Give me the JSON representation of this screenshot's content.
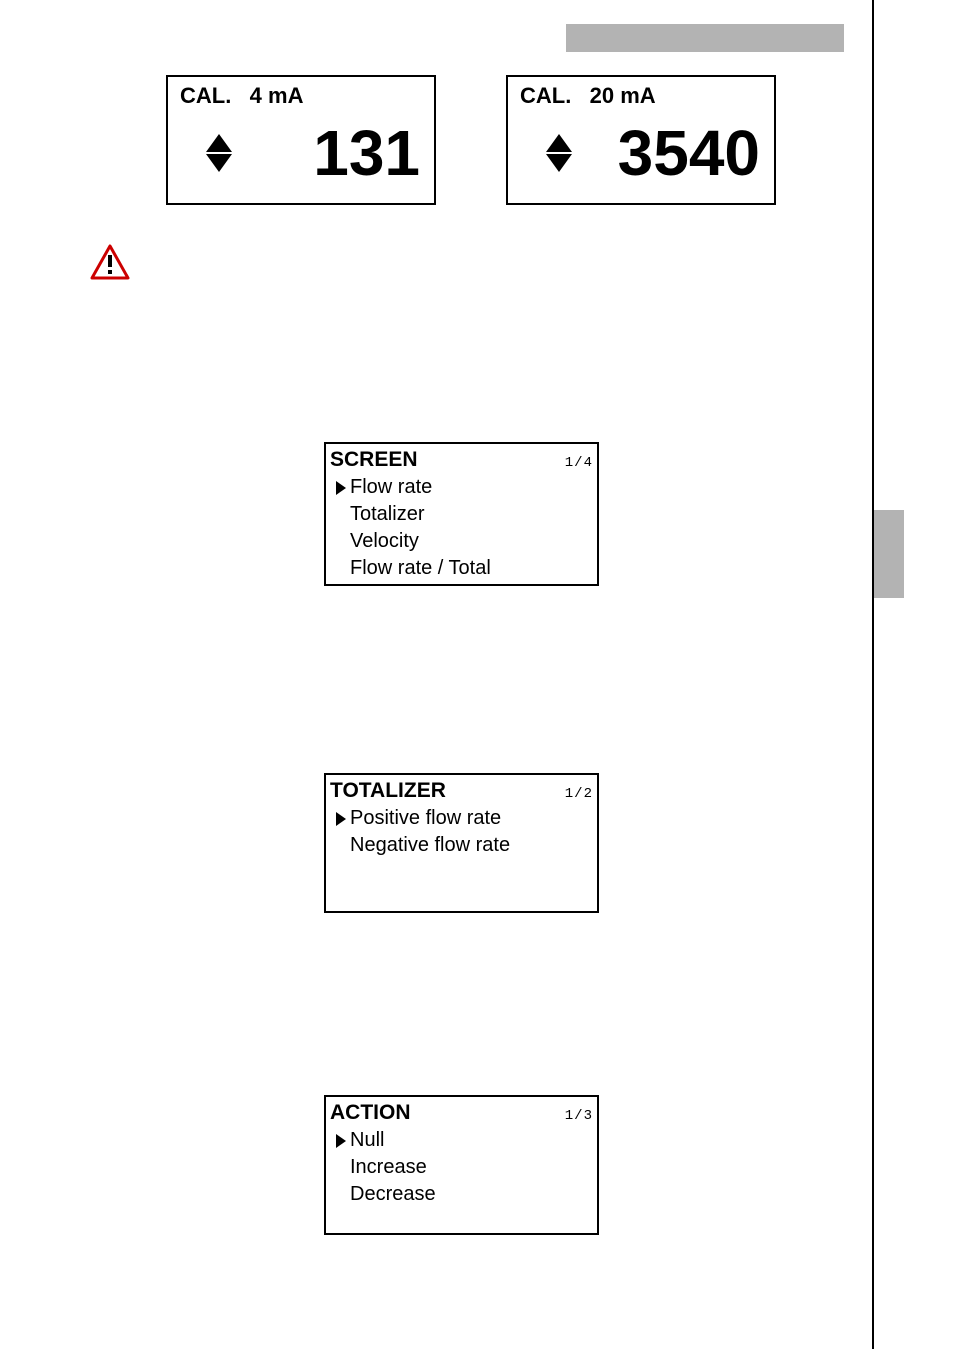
{
  "cal": {
    "left": {
      "label": "CAL.   4 mA",
      "value": "131"
    },
    "right": {
      "label": "CAL.   20 mA",
      "value": "3540"
    }
  },
  "menus": {
    "screen": {
      "title": "SCREEN",
      "page": "1/4",
      "items": [
        "Flow rate",
        "Totalizer",
        "Velocity",
        "Flow rate / Total"
      ],
      "selected": 0
    },
    "totalizer": {
      "title": "TOTALIZER",
      "page": "1/2",
      "items": [
        "Positive flow rate",
        "Negative flow rate"
      ],
      "selected": 0
    },
    "action": {
      "title": "ACTION",
      "page": "1/3",
      "items": [
        "Null",
        "Increase",
        "Decrease"
      ],
      "selected": 0
    }
  }
}
